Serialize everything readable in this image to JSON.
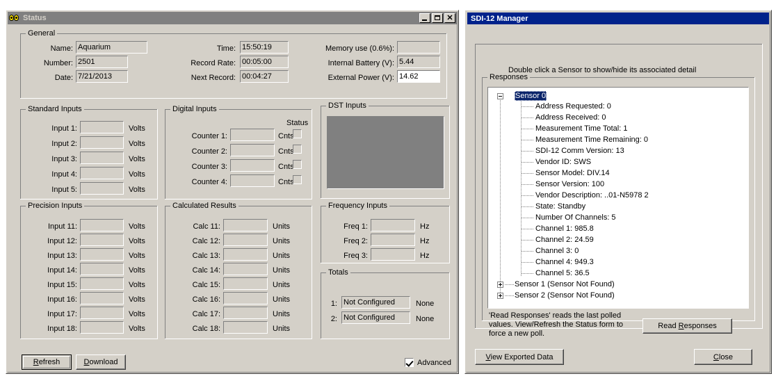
{
  "status_window": {
    "title": "Status",
    "icon": "goggles-icon",
    "title_buttons": {
      "minimize": "minimize-icon",
      "maximize": "maximize-icon",
      "close": "close-icon"
    },
    "general": {
      "legend": "General",
      "left_fields": [
        {
          "label": "Name:",
          "value": "Aquarium"
        },
        {
          "label": "Number:",
          "value": "2501"
        },
        {
          "label": "Date:",
          "value": "7/21/2013"
        }
      ],
      "mid_fields": [
        {
          "label": "Time:",
          "value": "15:50:19"
        },
        {
          "label": "Record Rate:",
          "value": "00:05:00"
        },
        {
          "label": "Next Record:",
          "value": "00:04:27"
        }
      ],
      "right_fields": [
        {
          "label": "Memory use (0.6%):",
          "value": "",
          "white": false
        },
        {
          "label": "Internal Battery (V):",
          "value": "5.44",
          "white": false
        },
        {
          "label": "External Power (V):",
          "value": "14.62",
          "white": true
        }
      ]
    },
    "standard_inputs": {
      "legend": "Standard Inputs",
      "unit": "Volts",
      "rows": [
        {
          "label": "Input 1:",
          "value": ""
        },
        {
          "label": "Input 2:",
          "value": ""
        },
        {
          "label": "Input 3:",
          "value": ""
        },
        {
          "label": "Input 4:",
          "value": ""
        },
        {
          "label": "Input 5:",
          "value": ""
        }
      ]
    },
    "digital_inputs": {
      "legend": "Digital Inputs",
      "unit": "Cnts",
      "status_header": "Status",
      "rows": [
        {
          "label": "Counter 1:",
          "value": "",
          "status": false
        },
        {
          "label": "Counter 2:",
          "value": "",
          "status": false
        },
        {
          "label": "Counter 3:",
          "value": "",
          "status": false
        },
        {
          "label": "Counter 4:",
          "value": "",
          "status": false
        }
      ]
    },
    "dst_inputs": {
      "legend": "DST Inputs",
      "content": ""
    },
    "precision_inputs": {
      "legend": "Precision Inputs",
      "unit": "Volts",
      "rows": [
        {
          "label": "Input 11:",
          "value": ""
        },
        {
          "label": "Input 12:",
          "value": ""
        },
        {
          "label": "Input 13:",
          "value": ""
        },
        {
          "label": "Input 14:",
          "value": ""
        },
        {
          "label": "Input 15:",
          "value": ""
        },
        {
          "label": "Input 16:",
          "value": ""
        },
        {
          "label": "Input 17:",
          "value": ""
        },
        {
          "label": "Input 18:",
          "value": ""
        }
      ]
    },
    "calculated_results": {
      "legend": "Calculated Results",
      "unit": "Units",
      "rows": [
        {
          "label": "Calc 11:",
          "value": ""
        },
        {
          "label": "Calc 12:",
          "value": ""
        },
        {
          "label": "Calc 13:",
          "value": ""
        },
        {
          "label": "Calc 14:",
          "value": ""
        },
        {
          "label": "Calc 15:",
          "value": ""
        },
        {
          "label": "Calc 16:",
          "value": ""
        },
        {
          "label": "Calc 17:",
          "value": ""
        },
        {
          "label": "Calc 18:",
          "value": ""
        }
      ]
    },
    "frequency_inputs": {
      "legend": "Frequency Inputs",
      "unit": "Hz",
      "rows": [
        {
          "label": "Freq 1:",
          "value": ""
        },
        {
          "label": "Freq 2:",
          "value": ""
        },
        {
          "label": "Freq 3:",
          "value": ""
        }
      ]
    },
    "totals": {
      "legend": "Totals",
      "rows": [
        {
          "label": "1:",
          "value": "Not Configured",
          "unit": "None"
        },
        {
          "label": "2:",
          "value": "Not Configured",
          "unit": "None"
        }
      ]
    },
    "footer": {
      "refresh_button": {
        "prefix": "",
        "accel": "R",
        "suffix": "efresh"
      },
      "download_button": {
        "prefix": "",
        "accel": "D",
        "suffix": "ownload"
      },
      "advanced_checkbox": {
        "prefix": "Ad",
        "accel": "v",
        "suffix": "anced",
        "checked": true
      }
    }
  },
  "sdi12_window": {
    "title": "SDI-12 Manager",
    "instruction": "Double click a Sensor to show/hide its associated detail",
    "responses": {
      "legend": "Responses",
      "tree": [
        {
          "label": "Sensor 0",
          "level": 0,
          "expander": "minus",
          "selected": true
        },
        {
          "label": "Address Requested: 0",
          "level": 1,
          "expander": "none",
          "selected": false
        },
        {
          "label": "Address Received: 0",
          "level": 1,
          "expander": "none",
          "selected": false
        },
        {
          "label": "Measurement Time Total: 1",
          "level": 1,
          "expander": "none",
          "selected": false
        },
        {
          "label": "Measurement Time Remaining: 0",
          "level": 1,
          "expander": "none",
          "selected": false
        },
        {
          "label": "SDI-12 Comm Version: 13",
          "level": 1,
          "expander": "none",
          "selected": false
        },
        {
          "label": "Vendor ID: SWS",
          "level": 1,
          "expander": "none",
          "selected": false
        },
        {
          "label": "Sensor Model: DIV.14",
          "level": 1,
          "expander": "none",
          "selected": false
        },
        {
          "label": "Sensor Version: 100",
          "level": 1,
          "expander": "none",
          "selected": false
        },
        {
          "label": "Vendor Description: ..01-N5978  2",
          "level": 1,
          "expander": "none",
          "selected": false
        },
        {
          "label": "State: Standby",
          "level": 1,
          "expander": "none",
          "selected": false
        },
        {
          "label": "Number Of Channels: 5",
          "level": 1,
          "expander": "none",
          "selected": false
        },
        {
          "label": "Channel 1: 985.8",
          "level": 1,
          "expander": "none",
          "selected": false
        },
        {
          "label": "Channel 2: 24.59",
          "level": 1,
          "expander": "none",
          "selected": false
        },
        {
          "label": "Channel 3: 0",
          "level": 1,
          "expander": "none",
          "selected": false
        },
        {
          "label": "Channel 4: 949.3",
          "level": 1,
          "expander": "none",
          "selected": false
        },
        {
          "label": "Channel 5: 36.5",
          "level": 1,
          "expander": "none",
          "selected": false
        },
        {
          "label": "Sensor 1     (Sensor Not Found)",
          "level": 0,
          "expander": "plus",
          "selected": false
        },
        {
          "label": "Sensor 2     (Sensor Not Found)",
          "level": 0,
          "expander": "plus",
          "selected": false
        }
      ],
      "help_text": "'Read Responses' reads the last polled values.  View/Refresh the Status form to force a new poll.",
      "read_responses_button": {
        "prefix": "Read ",
        "accel": "R",
        "suffix": "esponses"
      }
    },
    "footer": {
      "view_exported_button": {
        "prefix": "",
        "accel": "V",
        "suffix": "iew Exported Data"
      },
      "close_button": {
        "prefix": "",
        "accel": "C",
        "suffix": "lose"
      }
    }
  },
  "colors": {
    "face": "#d4d0c8",
    "inactive_title": "#808080",
    "active_title": "#00228b",
    "selection": "#0a246a",
    "disabled_field": "#d4d0c8",
    "dst_box": "#808080"
  }
}
